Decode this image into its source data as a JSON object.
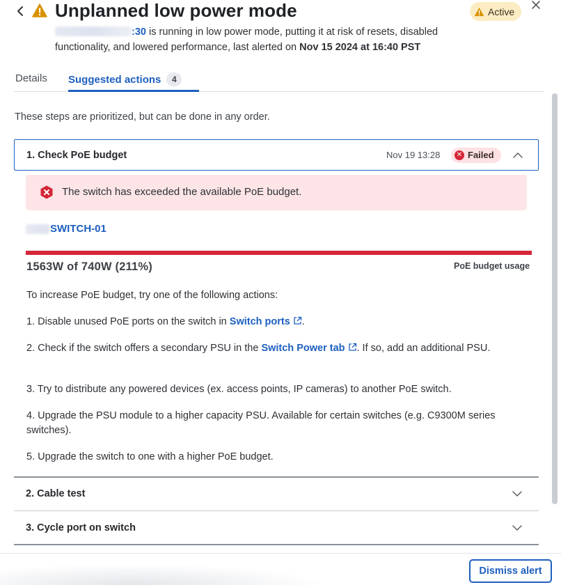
{
  "header": {
    "back_icon": "chevron-left-icon",
    "warning_icon": "warning-triangle-icon",
    "title": "Unplanned low power mode",
    "status_badge": "Active",
    "close_icon": "close-icon",
    "description_device_suffix": ":30",
    "description_text": " is running in low power mode, putting it at risk of resets, disabled functionality, and lowered performance, last alerted on ",
    "description_date": "Nov 15 2024 at 16:40 PST"
  },
  "tabs": {
    "details_label": "Details",
    "suggested_label": "Suggested actions",
    "suggested_count": "4"
  },
  "intro_text": "These steps are prioritized, but can be done in any order.",
  "steps": [
    {
      "title": "1. Check PoE budget",
      "date": "Nov 19 13:28",
      "status": "Failed",
      "expanded": true,
      "error_message": "The switch has exceeded the available PoE budget.",
      "switch_name": "SWITCH-01",
      "usage_value": "1563W of 740W (211%)",
      "usage_label": "PoE budget usage",
      "usage_fraction": 2.11,
      "intro": "To increase PoE budget, try one of the following actions:",
      "action1_prefix": "1. Disable unused PoE ports on the switch in ",
      "action1_link": "Switch ports",
      "action1_suffix": ".",
      "action2_prefix": "2. Check if the switch offers a secondary PSU in the ",
      "action2_link": "Switch Power tab",
      "action2_suffix": ". If so, add an additional PSU.",
      "action3": "3. Try to distribute any powered devices (ex. access points, IP cameras) to another PoE switch.",
      "action4": "4. Upgrade the PSU module to a higher capacity PSU. Available for certain switches (e.g. C9300M series switches).",
      "action5": "5. Upgrade the switch to one with a higher PoE budget."
    },
    {
      "title": "2. Cable test",
      "expanded": false
    },
    {
      "title": "3. Cycle port on switch",
      "expanded": false
    }
  ],
  "footer": {
    "dismiss_label": "Dismiss alert"
  },
  "colors": {
    "accent": "#1d5fbf",
    "error": "#d42637",
    "warning": "#d99100",
    "active_badge_bg": "#fcecc3",
    "error_bg": "#fde5e7"
  }
}
